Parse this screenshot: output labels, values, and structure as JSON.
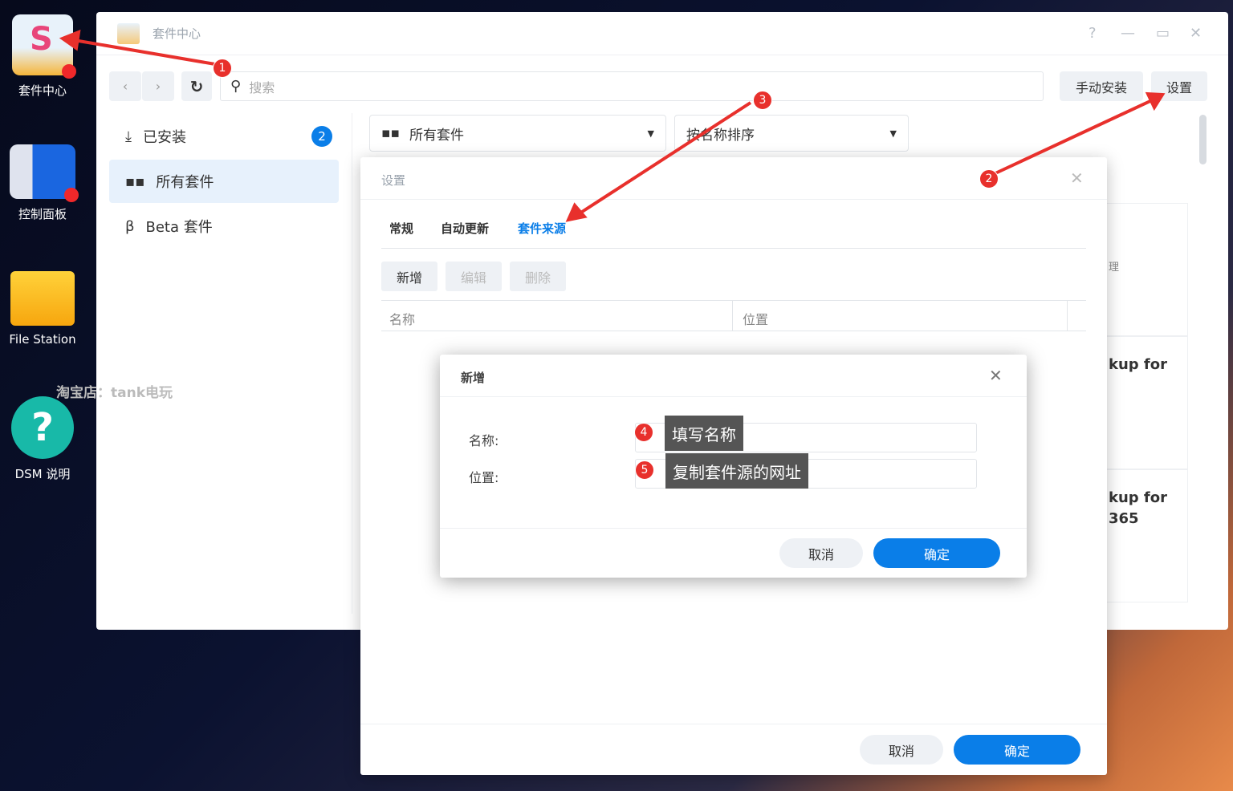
{
  "desktop": {
    "icons": [
      {
        "label": "套件中心"
      },
      {
        "label": "控制面板"
      },
      {
        "label": "File Station"
      },
      {
        "label": "DSM 说明"
      }
    ],
    "watermark": "淘宝店：tank电玩"
  },
  "window": {
    "title": "套件中心",
    "help": "?",
    "minimize": "—",
    "maximize": "▭",
    "close": "✕"
  },
  "toolbar": {
    "search_placeholder": "搜索",
    "manual_install": "手动安装",
    "settings": "设置"
  },
  "sidebar": {
    "items": [
      {
        "label": "已安装",
        "badge": "2"
      },
      {
        "label": "所有套件"
      },
      {
        "label": "Beta 套件"
      }
    ]
  },
  "filters": {
    "category": "所有套件",
    "sort": "按名称排序"
  },
  "background_cards": [
    "理",
    "kup for",
    "kup for",
    "365"
  ],
  "settings_dialog": {
    "title": "设置",
    "tabs": [
      "常规",
      "自动更新",
      "套件来源"
    ],
    "active_tab": "套件来源",
    "actions": [
      "新增",
      "编辑",
      "删除"
    ],
    "columns": [
      "名称",
      "位置"
    ],
    "cancel": "取消",
    "ok": "确定"
  },
  "add_dialog": {
    "title": "新增",
    "name_label": "名称:",
    "location_label": "位置:",
    "cancel": "取消",
    "ok": "确定"
  },
  "annotations": {
    "steps": [
      "1",
      "2",
      "3",
      "4",
      "5"
    ],
    "tip_name": "填写名称",
    "tip_location": "复制套件源的网址"
  },
  "colors": {
    "accent": "#0a7ee8",
    "annotation": "#e8302c"
  }
}
